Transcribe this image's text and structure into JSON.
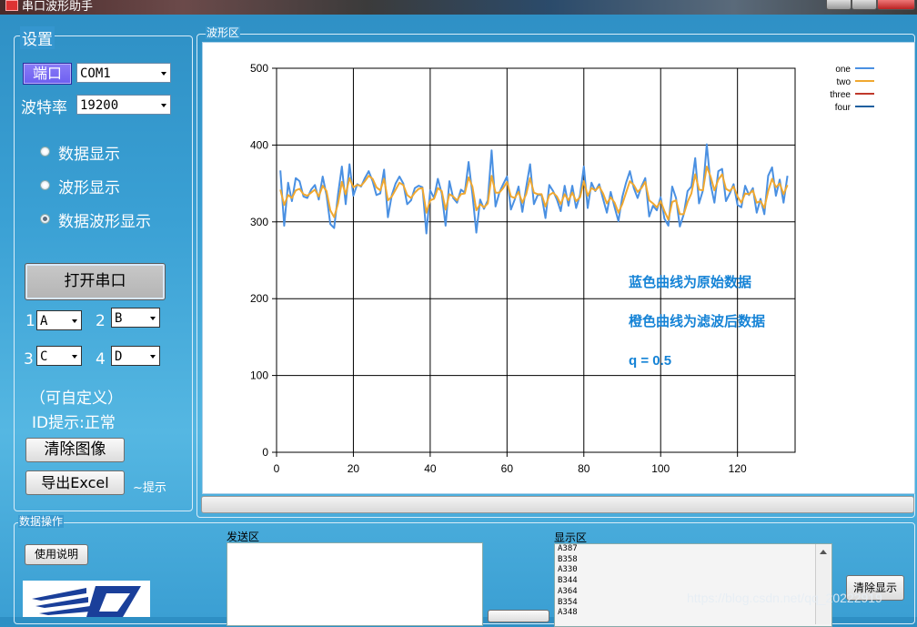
{
  "window": {
    "title": "串口波形助手"
  },
  "settings": {
    "group_label": "设置",
    "port_label": "端口",
    "port_value": "COM1",
    "baud_label": "波特率",
    "baud_value": "19200",
    "display_modes": [
      {
        "label": "数据显示",
        "selected": false
      },
      {
        "label": "波形显示",
        "selected": false
      },
      {
        "label": "数据波形显示",
        "selected": true
      }
    ],
    "open_port_button": "打开串口",
    "channels": [
      {
        "index": "1",
        "value": "A"
      },
      {
        "index": "2",
        "value": "B"
      },
      {
        "index": "3",
        "value": "C"
      },
      {
        "index": "4",
        "value": "D"
      }
    ],
    "custom_hint": "（可自定义）",
    "id_status": "ID提示:正常",
    "clear_image_button": "清除图像",
    "export_excel_button": "导出Excel",
    "tip_label": "~提示"
  },
  "waveform": {
    "group_label": "波形区"
  },
  "chart_data": {
    "type": "line",
    "xlim": [
      0,
      135
    ],
    "ylim": [
      0,
      500
    ],
    "x_ticks": [
      "0",
      "20",
      "40",
      "60",
      "80",
      "100",
      "120"
    ],
    "y_ticks": [
      "0",
      "100",
      "200",
      "300",
      "400",
      "500"
    ],
    "grid": true,
    "legend_position": "top-right",
    "series": [
      {
        "name": "one",
        "color": "#4a90e2",
        "values": [
          367,
          295,
          351,
          327,
          357,
          353,
          333,
          331,
          342,
          348,
          329,
          359,
          335,
          297,
          292,
          336,
          372,
          323,
          375,
          334,
          349,
          346,
          357,
          366,
          353,
          335,
          337,
          368,
          306,
          335,
          350,
          359,
          350,
          323,
          328,
          344,
          347,
          345,
          285,
          341,
          331,
          356,
          337,
          295,
          353,
          331,
          325,
          342,
          338,
          378,
          336,
          286,
          329,
          317,
          328,
          393,
          320,
          338,
          349,
          359,
          316,
          329,
          346,
          313,
          345,
          375,
          323,
          335,
          335,
          305,
          348,
          340,
          329,
          314,
          347,
          321,
          347,
          318,
          335,
          372,
          318,
          351,
          340,
          349,
          330,
          312,
          339,
          319,
          301,
          332,
          351,
          366,
          344,
          331,
          346,
          357,
          307,
          321,
          315,
          332,
          304,
          295,
          346,
          331,
          294,
          310,
          340,
          346,
          383,
          324,
          341,
          401,
          349,
          325,
          366,
          369,
          327,
          337,
          349,
          322,
          319,
          347,
          335,
          344,
          312,
          330,
          310,
          360,
          371,
          334,
          355,
          325,
          360
        ]
      },
      {
        "name": "two",
        "color": "#f0a830",
        "values": [
          342,
          322,
          335,
          331,
          341,
          343,
          336,
          334,
          338,
          342,
          333,
          347,
          340,
          315,
          306,
          324,
          352,
          336,
          357,
          345,
          348,
          347,
          353,
          360,
          356,
          345,
          341,
          356,
          328,
          333,
          342,
          351,
          348,
          335,
          331,
          338,
          343,
          344,
          312,
          328,
          330,
          344,
          340,
          316,
          336,
          333,
          328,
          336,
          337,
          358,
          346,
          315,
          323,
          319,
          324,
          360,
          338,
          338,
          344,
          352,
          333,
          331,
          339,
          325,
          336,
          357,
          338,
          336,
          336,
          320,
          335,
          338,
          333,
          323,
          336,
          328,
          338,
          327,
          332,
          353,
          334,
          344,
          341,
          346,
          337,
          324,
          332,
          325,
          312,
          323,
          338,
          353,
          348,
          339,
          344,
          352,
          328,
          324,
          319,
          327,
          314,
          303,
          326,
          328,
          310,
          310,
          326,
          337,
          362,
          342,
          341,
          372,
          359,
          341,
          355,
          362,
          343,
          340,
          346,
          333,
          325,
          337,
          336,
          341,
          325,
          327,
          318,
          340,
          356,
          345,
          350,
          336,
          348
        ]
      },
      {
        "name": "three",
        "color": "#c0392b",
        "values": []
      },
      {
        "name": "four",
        "color": "#1f5f9f",
        "values": []
      }
    ]
  },
  "chart_notes": [
    "蓝色曲线为原始数据",
    "橙色曲线为滤波后数据",
    "q = 0.5"
  ],
  "data_ops": {
    "group_label": "数据操作",
    "help_button": "使用说明",
    "send_label": "发送区",
    "display_label": "显示区",
    "display_lines": [
      "A387",
      "B358",
      "A330",
      "B344",
      "A364",
      "B354",
      "A348"
    ],
    "clear_display_button": "清除显示"
  },
  "watermark": "https://blog.csdn.net/qq_20222919"
}
